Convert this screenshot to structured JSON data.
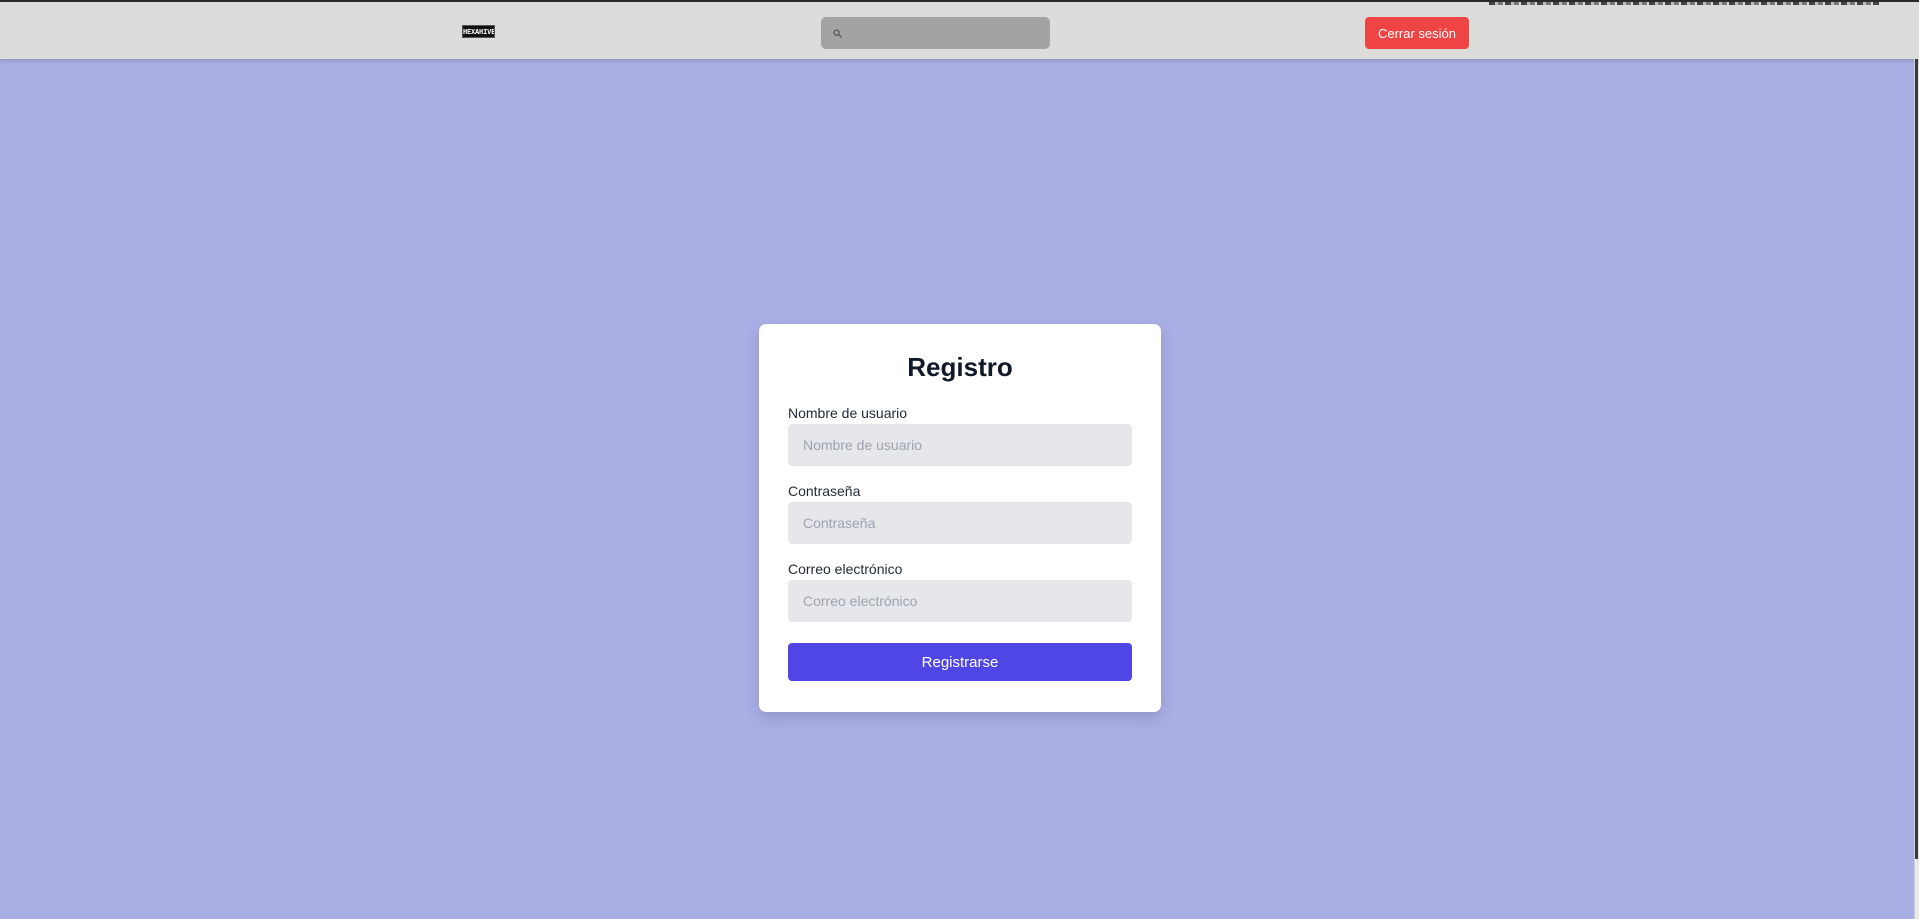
{
  "header": {
    "logo_text": "HEXAHIVE",
    "search_placeholder": "",
    "search_icon": "search-icon",
    "logout_label": "Cerrar sesión"
  },
  "form": {
    "title": "Registro",
    "fields": [
      {
        "label": "Nombre de usuario",
        "placeholder": "Nombre de usuario",
        "value": ""
      },
      {
        "label": "Contraseña",
        "placeholder": "Contraseña",
        "value": ""
      },
      {
        "label": "Correo electrónico",
        "placeholder": "Correo electrónico",
        "value": ""
      }
    ],
    "submit_label": "Registrarse"
  },
  "colors": {
    "background": "#a9afe5",
    "header_background": "#dcdcda",
    "logout_button": "#ef4444",
    "submit_button": "#4f46e5",
    "input_background": "#e5e7eb"
  }
}
